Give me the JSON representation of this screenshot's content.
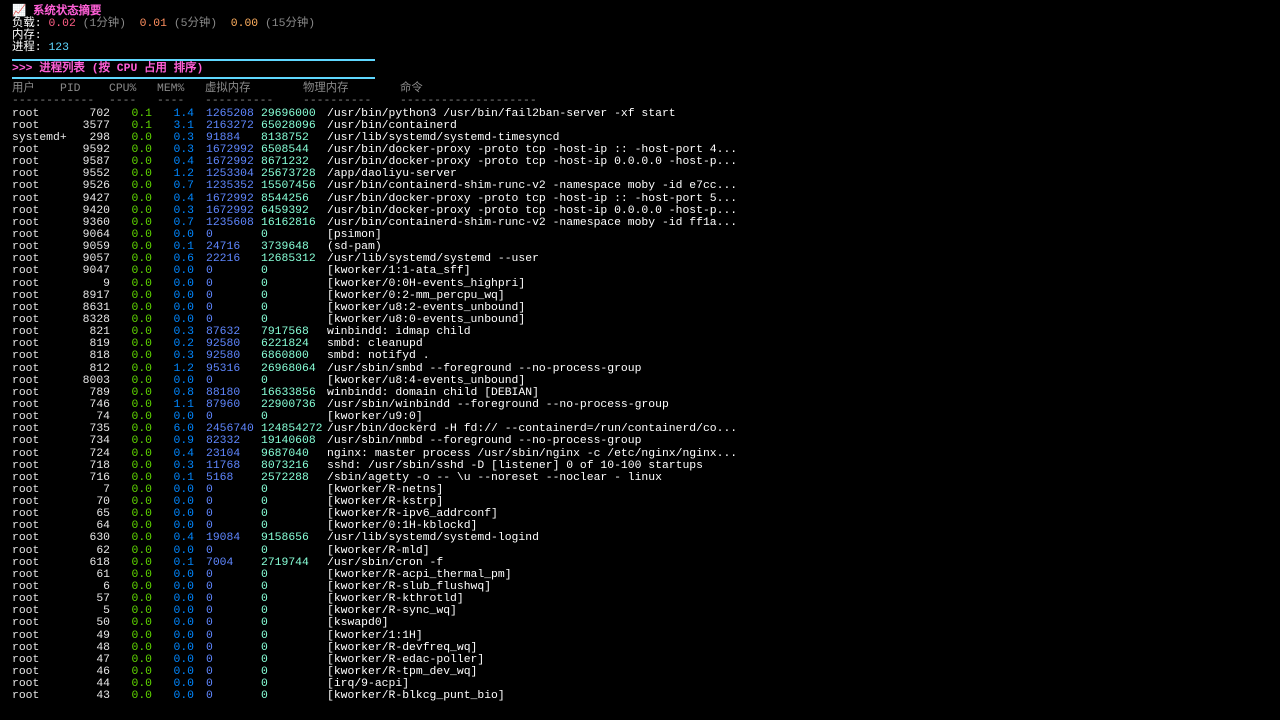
{
  "summary": {
    "icon": "chart-increasing-icon",
    "icon_glyph": "📈",
    "title": "系统状态摘要",
    "load_label": "负载:",
    "load_1": "0.02",
    "load_1_unit": "(1分钟)",
    "load_5": "0.01",
    "load_5_unit": "(5分钟)",
    "load_15": "0.00",
    "load_15_unit": "(15分钟)",
    "memory_label": "内存:",
    "process_label": "进程:",
    "process_count": "123"
  },
  "process_section": {
    "title": ">>> 进程列表 (按 CPU 占用 排序)",
    "headers": [
      "用户",
      "PID",
      "CPU%",
      "MEM%",
      "虚拟内存",
      "物理内存",
      "命令"
    ],
    "dashes": [
      "--------",
      "-----",
      "----",
      "----",
      "----------",
      "----------",
      "--------------------"
    ]
  },
  "processes": [
    {
      "user": "root",
      "pid": "702",
      "cpu": "0.1",
      "mem": "1.4",
      "vsz": "1265208",
      "rss": "29696000",
      "cmd": "/usr/bin/python3 /usr/bin/fail2ban-server -xf start"
    },
    {
      "user": "root",
      "pid": "3577",
      "cpu": "0.1",
      "mem": "3.1",
      "vsz": "2163272",
      "rss": "65028096",
      "cmd": "/usr/bin/containerd"
    },
    {
      "user": "systemd+",
      "pid": "298",
      "cpu": "0.0",
      "mem": "0.3",
      "vsz": "91884",
      "rss": "8138752",
      "cmd": "/usr/lib/systemd/systemd-timesyncd"
    },
    {
      "user": "root",
      "pid": "9592",
      "cpu": "0.0",
      "mem": "0.3",
      "vsz": "1672992",
      "rss": "6508544",
      "cmd": "/usr/bin/docker-proxy -proto tcp -host-ip :: -host-port 4..."
    },
    {
      "user": "root",
      "pid": "9587",
      "cpu": "0.0",
      "mem": "0.4",
      "vsz": "1672992",
      "rss": "8671232",
      "cmd": "/usr/bin/docker-proxy -proto tcp -host-ip 0.0.0.0 -host-p..."
    },
    {
      "user": "root",
      "pid": "9552",
      "cpu": "0.0",
      "mem": "1.2",
      "vsz": "1253304",
      "rss": "25673728",
      "cmd": "/app/daoliyu-server"
    },
    {
      "user": "root",
      "pid": "9526",
      "cpu": "0.0",
      "mem": "0.7",
      "vsz": "1235352",
      "rss": "15507456",
      "cmd": "/usr/bin/containerd-shim-runc-v2 -namespace moby -id e7cc..."
    },
    {
      "user": "root",
      "pid": "9427",
      "cpu": "0.0",
      "mem": "0.4",
      "vsz": "1672992",
      "rss": "8544256",
      "cmd": "/usr/bin/docker-proxy -proto tcp -host-ip :: -host-port 5..."
    },
    {
      "user": "root",
      "pid": "9420",
      "cpu": "0.0",
      "mem": "0.3",
      "vsz": "1672992",
      "rss": "6459392",
      "cmd": "/usr/bin/docker-proxy -proto tcp -host-ip 0.0.0.0 -host-p..."
    },
    {
      "user": "root",
      "pid": "9360",
      "cpu": "0.0",
      "mem": "0.7",
      "vsz": "1235608",
      "rss": "16162816",
      "cmd": "/usr/bin/containerd-shim-runc-v2 -namespace moby -id ff1a..."
    },
    {
      "user": "root",
      "pid": "9064",
      "cpu": "0.0",
      "mem": "0.0",
      "vsz": "0",
      "rss": "0",
      "cmd": "[psimon]"
    },
    {
      "user": "root",
      "pid": "9059",
      "cpu": "0.0",
      "mem": "0.1",
      "vsz": "24716",
      "rss": "3739648",
      "cmd": "(sd-pam)"
    },
    {
      "user": "root",
      "pid": "9057",
      "cpu": "0.0",
      "mem": "0.6",
      "vsz": "22216",
      "rss": "12685312",
      "cmd": "/usr/lib/systemd/systemd --user"
    },
    {
      "user": "root",
      "pid": "9047",
      "cpu": "0.0",
      "mem": "0.0",
      "vsz": "0",
      "rss": "0",
      "cmd": "[kworker/1:1-ata_sff]"
    },
    {
      "user": "root",
      "pid": "9",
      "cpu": "0.0",
      "mem": "0.0",
      "vsz": "0",
      "rss": "0",
      "cmd": "[kworker/0:0H-events_highpri]"
    },
    {
      "user": "root",
      "pid": "8917",
      "cpu": "0.0",
      "mem": "0.0",
      "vsz": "0",
      "rss": "0",
      "cmd": "[kworker/0:2-mm_percpu_wq]"
    },
    {
      "user": "root",
      "pid": "8631",
      "cpu": "0.0",
      "mem": "0.0",
      "vsz": "0",
      "rss": "0",
      "cmd": "[kworker/u8:2-events_unbound]"
    },
    {
      "user": "root",
      "pid": "8328",
      "cpu": "0.0",
      "mem": "0.0",
      "vsz": "0",
      "rss": "0",
      "cmd": "[kworker/u8:0-events_unbound]"
    },
    {
      "user": "root",
      "pid": "821",
      "cpu": "0.0",
      "mem": "0.3",
      "vsz": "87632",
      "rss": "7917568",
      "cmd": "winbindd: idmap child"
    },
    {
      "user": "root",
      "pid": "819",
      "cpu": "0.0",
      "mem": "0.2",
      "vsz": "92580",
      "rss": "6221824",
      "cmd": "smbd: cleanupd"
    },
    {
      "user": "root",
      "pid": "818",
      "cpu": "0.0",
      "mem": "0.3",
      "vsz": "92580",
      "rss": "6860800",
      "cmd": "smbd: notifyd ."
    },
    {
      "user": "root",
      "pid": "812",
      "cpu": "0.0",
      "mem": "1.2",
      "vsz": "95316",
      "rss": "26968064",
      "cmd": "/usr/sbin/smbd --foreground --no-process-group"
    },
    {
      "user": "root",
      "pid": "8003",
      "cpu": "0.0",
      "mem": "0.0",
      "vsz": "0",
      "rss": "0",
      "cmd": "[kworker/u8:4-events_unbound]"
    },
    {
      "user": "root",
      "pid": "789",
      "cpu": "0.0",
      "mem": "0.8",
      "vsz": "88180",
      "rss": "16633856",
      "cmd": "winbindd: domain child [DEBIAN]"
    },
    {
      "user": "root",
      "pid": "746",
      "cpu": "0.0",
      "mem": "1.1",
      "vsz": "87960",
      "rss": "22900736",
      "cmd": "/usr/sbin/winbindd --foreground --no-process-group"
    },
    {
      "user": "root",
      "pid": "74",
      "cpu": "0.0",
      "mem": "0.0",
      "vsz": "0",
      "rss": "0",
      "cmd": "[kworker/u9:0]"
    },
    {
      "user": "root",
      "pid": "735",
      "cpu": "0.0",
      "mem": "6.0",
      "vsz": "2456740",
      "rss": "124854272",
      "cmd": "/usr/bin/dockerd -H fd:// --containerd=/run/containerd/co..."
    },
    {
      "user": "root",
      "pid": "734",
      "cpu": "0.0",
      "mem": "0.9",
      "vsz": "82332",
      "rss": "19140608",
      "cmd": "/usr/sbin/nmbd --foreground --no-process-group"
    },
    {
      "user": "root",
      "pid": "724",
      "cpu": "0.0",
      "mem": "0.4",
      "vsz": "23104",
      "rss": "9687040",
      "cmd": "nginx: master process /usr/sbin/nginx -c /etc/nginx/nginx..."
    },
    {
      "user": "root",
      "pid": "718",
      "cpu": "0.0",
      "mem": "0.3",
      "vsz": "11768",
      "rss": "8073216",
      "cmd": "sshd: /usr/sbin/sshd -D [listener] 0 of 10-100 startups"
    },
    {
      "user": "root",
      "pid": "716",
      "cpu": "0.0",
      "mem": "0.1",
      "vsz": "5168",
      "rss": "2572288",
      "cmd": "/sbin/agetty -o -- \\u --noreset --noclear - linux"
    },
    {
      "user": "root",
      "pid": "7",
      "cpu": "0.0",
      "mem": "0.0",
      "vsz": "0",
      "rss": "0",
      "cmd": "[kworker/R-netns]"
    },
    {
      "user": "root",
      "pid": "70",
      "cpu": "0.0",
      "mem": "0.0",
      "vsz": "0",
      "rss": "0",
      "cmd": "[kworker/R-kstrp]"
    },
    {
      "user": "root",
      "pid": "65",
      "cpu": "0.0",
      "mem": "0.0",
      "vsz": "0",
      "rss": "0",
      "cmd": "[kworker/R-ipv6_addrconf]"
    },
    {
      "user": "root",
      "pid": "64",
      "cpu": "0.0",
      "mem": "0.0",
      "vsz": "0",
      "rss": "0",
      "cmd": "[kworker/0:1H-kblockd]"
    },
    {
      "user": "root",
      "pid": "630",
      "cpu": "0.0",
      "mem": "0.4",
      "vsz": "19084",
      "rss": "9158656",
      "cmd": "/usr/lib/systemd/systemd-logind"
    },
    {
      "user": "root",
      "pid": "62",
      "cpu": "0.0",
      "mem": "0.0",
      "vsz": "0",
      "rss": "0",
      "cmd": "[kworker/R-mld]"
    },
    {
      "user": "root",
      "pid": "618",
      "cpu": "0.0",
      "mem": "0.1",
      "vsz": "7004",
      "rss": "2719744",
      "cmd": "/usr/sbin/cron -f"
    },
    {
      "user": "root",
      "pid": "61",
      "cpu": "0.0",
      "mem": "0.0",
      "vsz": "0",
      "rss": "0",
      "cmd": "[kworker/R-acpi_thermal_pm]"
    },
    {
      "user": "root",
      "pid": "6",
      "cpu": "0.0",
      "mem": "0.0",
      "vsz": "0",
      "rss": "0",
      "cmd": "[kworker/R-slub_flushwq]"
    },
    {
      "user": "root",
      "pid": "57",
      "cpu": "0.0",
      "mem": "0.0",
      "vsz": "0",
      "rss": "0",
      "cmd": "[kworker/R-kthrotld]"
    },
    {
      "user": "root",
      "pid": "5",
      "cpu": "0.0",
      "mem": "0.0",
      "vsz": "0",
      "rss": "0",
      "cmd": "[kworker/R-sync_wq]"
    },
    {
      "user": "root",
      "pid": "50",
      "cpu": "0.0",
      "mem": "0.0",
      "vsz": "0",
      "rss": "0",
      "cmd": "[kswapd0]"
    },
    {
      "user": "root",
      "pid": "49",
      "cpu": "0.0",
      "mem": "0.0",
      "vsz": "0",
      "rss": "0",
      "cmd": "[kworker/1:1H]"
    },
    {
      "user": "root",
      "pid": "48",
      "cpu": "0.0",
      "mem": "0.0",
      "vsz": "0",
      "rss": "0",
      "cmd": "[kworker/R-devfreq_wq]"
    },
    {
      "user": "root",
      "pid": "47",
      "cpu": "0.0",
      "mem": "0.0",
      "vsz": "0",
      "rss": "0",
      "cmd": "[kworker/R-edac-poller]"
    },
    {
      "user": "root",
      "pid": "46",
      "cpu": "0.0",
      "mem": "0.0",
      "vsz": "0",
      "rss": "0",
      "cmd": "[kworker/R-tpm_dev_wq]"
    },
    {
      "user": "root",
      "pid": "44",
      "cpu": "0.0",
      "mem": "0.0",
      "vsz": "0",
      "rss": "0",
      "cmd": "[irq/9-acpi]"
    },
    {
      "user": "root",
      "pid": "43",
      "cpu": "0.0",
      "mem": "0.0",
      "vsz": "0",
      "rss": "0",
      "cmd": "[kworker/R-blkcg_punt_bio]"
    }
  ],
  "colors": {
    "background": "#000000",
    "title": "#ff5fd7",
    "separator": "#5fd7ff",
    "cpu": "#5fd700",
    "mem": "#0087ff",
    "vsz": "#5f87ff",
    "rss": "#87ffd7"
  }
}
